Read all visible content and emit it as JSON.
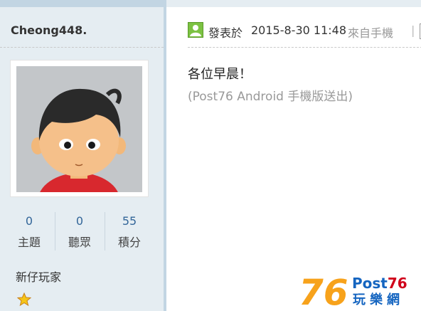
{
  "user": {
    "name": "Cheong448.",
    "stats": [
      {
        "value": "0",
        "label": "主題"
      },
      {
        "value": "0",
        "label": "聽眾"
      },
      {
        "value": "55",
        "label": "積分"
      }
    ],
    "rank": "新仔玩家",
    "rank_icon": "star-icon"
  },
  "post": {
    "icon": "user-online-icon",
    "posted_label": "發表於",
    "posted_date": "2015-8-30 11:48",
    "posted_source": "來自手機",
    "header_separator": "|",
    "content": "各位早晨！",
    "sent_from": "(Post76 Android 手機版送出)"
  },
  "logo": {
    "number": "76",
    "brand_prefix": "Post",
    "brand_suffix": "76",
    "brand_chinese": "玩樂網"
  },
  "colors": {
    "sidebar_bg": "#e5edf2",
    "accent_blue": "#336699",
    "logo_orange": "#f7a21b",
    "logo_red": "#d0021b",
    "logo_blue": "#1565c0",
    "star_yellow": "#f5c518"
  }
}
